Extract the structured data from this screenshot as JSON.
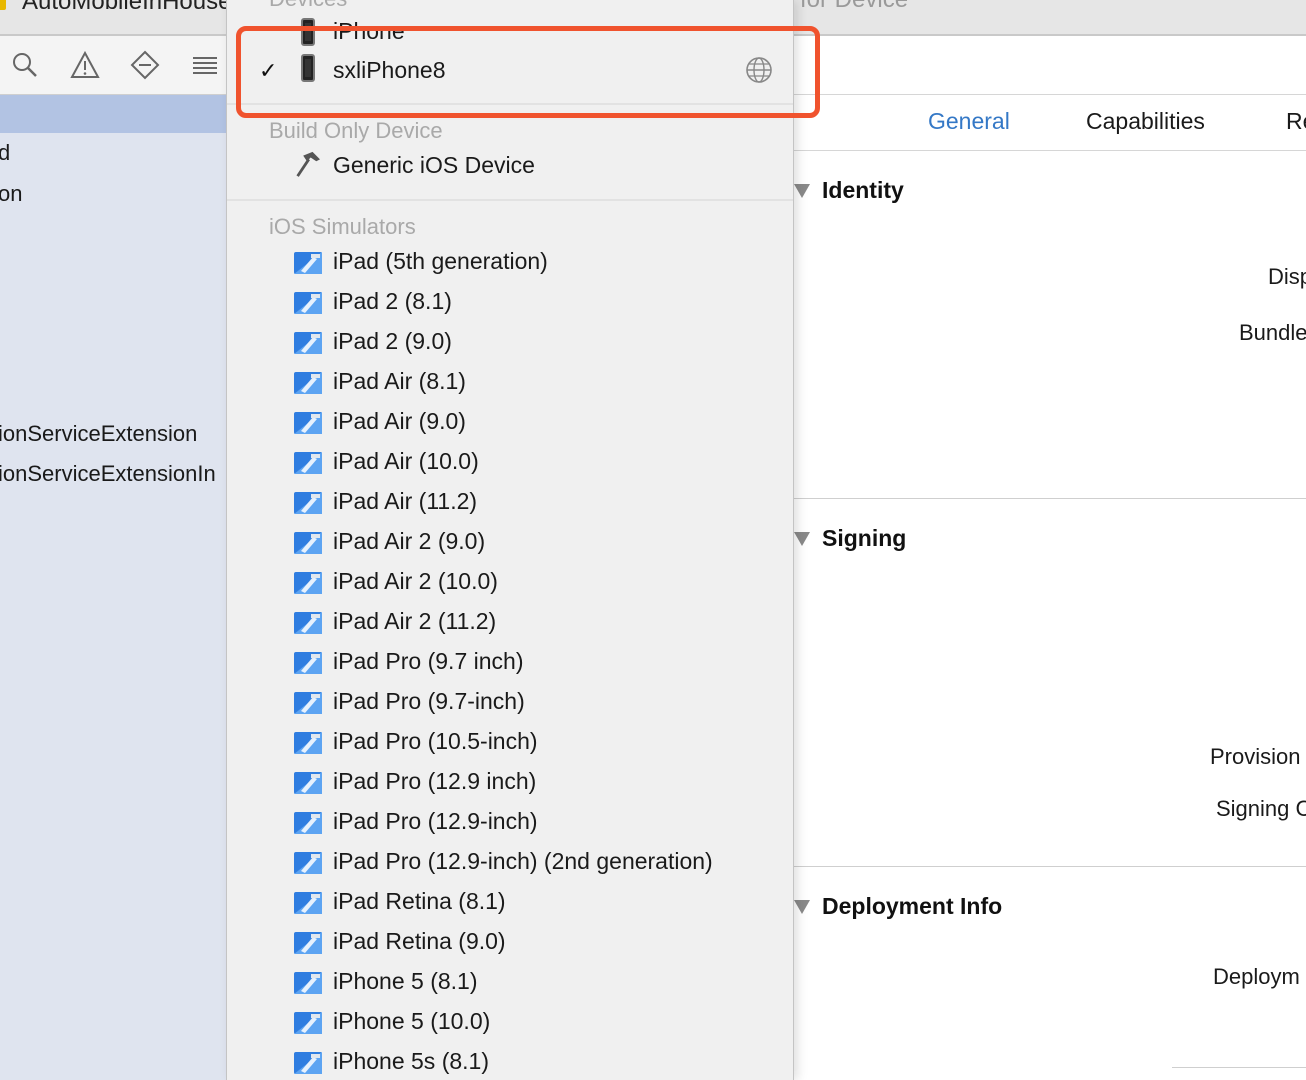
{
  "toolbar": {
    "scheme_label": "AutoMobileInHouse",
    "destination_label": "for Device"
  },
  "navigator": {
    "items": [
      {
        "label": "d"
      },
      {
        "label": "on"
      },
      {
        "label": "ionServiceExtension"
      },
      {
        "label": "ionServiceExtensionIn"
      }
    ]
  },
  "menu": {
    "devices_header": "Devices",
    "partial_device": "iPhone",
    "selected_device": {
      "label": "sxliPhone8",
      "checkmark": "✓",
      "icon": "iphone-icon"
    },
    "build_only_header": "Build Only Device",
    "generic_device": {
      "label": "Generic iOS Device",
      "icon": "hammer-icon"
    },
    "simulators_header": "iOS Simulators",
    "simulators": [
      "iPad (5th generation)",
      "iPad 2 (8.1)",
      "iPad 2 (9.0)",
      "iPad Air (8.1)",
      "iPad Air (9.0)",
      "iPad Air (10.0)",
      "iPad Air (11.2)",
      "iPad Air 2 (9.0)",
      "iPad Air 2 (10.0)",
      "iPad Air 2 (11.2)",
      "iPad Pro (9.7 inch)",
      "iPad Pro (9.7-inch)",
      "iPad Pro (10.5-inch)",
      "iPad Pro (12.9 inch)",
      "iPad Pro (12.9-inch)",
      "iPad Pro (12.9-inch) (2nd generation)",
      "iPad Retina (8.1)",
      "iPad Retina (9.0)",
      "iPhone 5 (8.1)",
      "iPhone 5 (10.0)",
      "iPhone 5s (8.1)"
    ]
  },
  "editor": {
    "tabs": [
      {
        "label": "General",
        "active": true
      },
      {
        "label": "Capabilities",
        "active": false
      },
      {
        "label": "Re",
        "active": false
      }
    ],
    "sections": {
      "identity": {
        "title": "Identity",
        "fields": [
          "Disp",
          "Bundle"
        ]
      },
      "signing": {
        "title": "Signing",
        "fields": [
          "Provision",
          "Signing C"
        ]
      },
      "deployment": {
        "title": "Deployment Info",
        "fields": [
          "Deploym"
        ]
      }
    }
  },
  "colors": {
    "accent": "#3478c6",
    "highlight": "#f0532e",
    "nav_selected": "#b2c3e3"
  }
}
